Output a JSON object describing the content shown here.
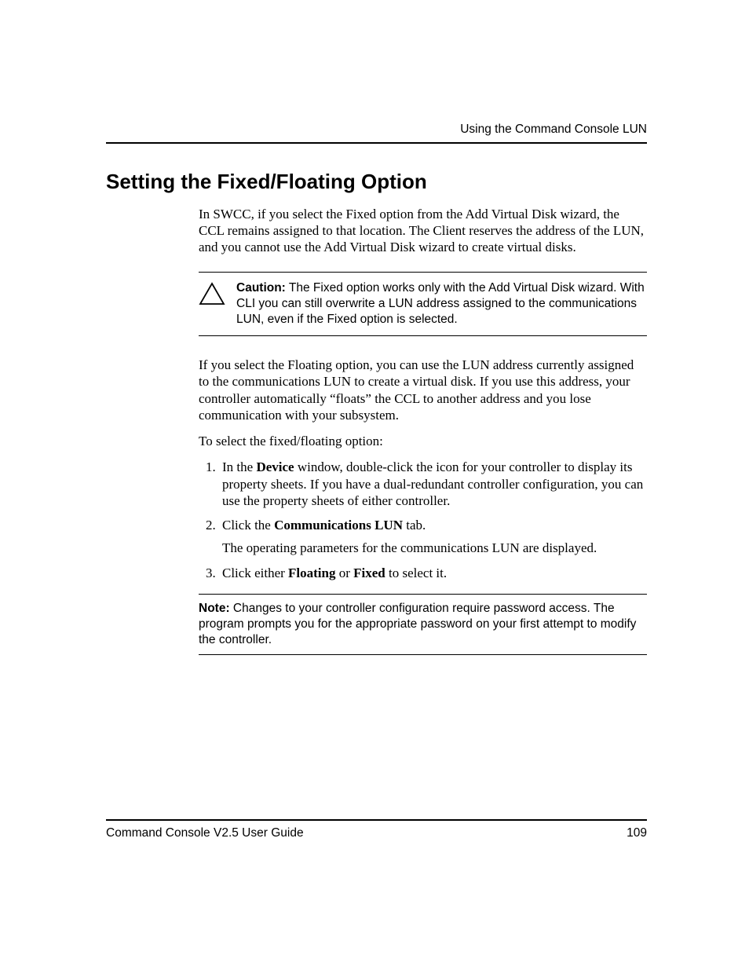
{
  "header": {
    "running_head": "Using the Command Console LUN"
  },
  "title": "Setting the Fixed/Floating Option",
  "body": {
    "intro": "In SWCC, if you select the Fixed option from the Add Virtual Disk wizard, the CCL remains assigned to that location. The Client reserves the address of the LUN, and you cannot use the Add Virtual Disk wizard to create virtual disks.",
    "caution": {
      "label": "Caution:",
      "text": "The Fixed option works only with the Add Virtual Disk wizard. With CLI you can still overwrite a LUN address assigned to the communications LUN, even if the Fixed option is selected."
    },
    "para2": "If you select the Floating option, you can use the LUN address currently assigned to the communications LUN to create a virtual disk. If you use this address, your controller automatically “floats” the CCL to another address and you lose communication with your subsystem.",
    "para3": "To select the fixed/floating option:",
    "steps": {
      "s1a": "In the ",
      "s1b": "Device",
      "s1c": " window, double-click the icon for your controller to display its property sheets. If you have a dual-redundant controller configuration, you can use the property sheets of either controller.",
      "s2a": "Click the ",
      "s2b": "Communications LUN",
      "s2c": " tab.",
      "s2d": "The operating parameters for the communications LUN are displayed.",
      "s3a": "Click either ",
      "s3b": "Floating",
      "s3c": " or ",
      "s3d": "Fixed",
      "s3e": " to select it."
    },
    "note": {
      "label": "Note:",
      "text": "Changes to your controller configuration require password access. The program prompts you for the appropriate password on your first attempt to modify the controller."
    }
  },
  "footer": {
    "doc_title": "Command Console V2.5 User Guide",
    "page_number": "109"
  }
}
